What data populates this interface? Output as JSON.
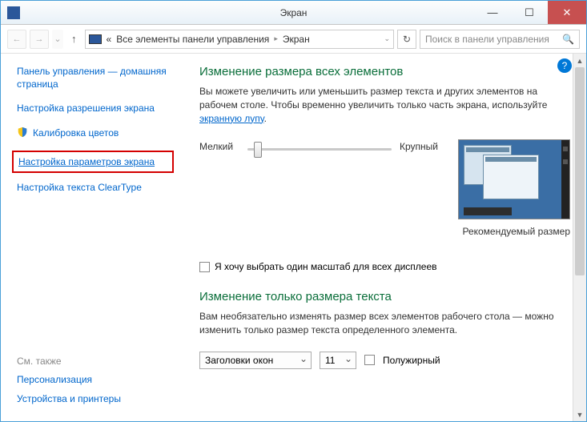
{
  "window": {
    "title": "Экран"
  },
  "breadcrumb": {
    "root": "Все элементы панели управления",
    "current": "Экран"
  },
  "search": {
    "placeholder": "Поиск в панели управления"
  },
  "sidebar": {
    "items": [
      "Панель управления — домашняя страница",
      "Настройка разрешения экрана",
      "Калибровка цветов",
      "Настройка параметров экрана",
      "Настройка текста ClearType"
    ],
    "seealso_header": "См. также",
    "seealso": [
      "Персонализация",
      "Устройства и принтеры"
    ]
  },
  "main": {
    "h1": "Изменение размера всех элементов",
    "desc_pre": "Вы можете увеличить или уменьшить размер текста и других элементов на рабочем столе. Чтобы временно увеличить только часть экрана, используйте ",
    "desc_link": "экранную лупу",
    "slider_min": "Мелкий",
    "slider_max": "Крупный",
    "recommended": "Рекомендуемый размер",
    "checkbox_label": "Я хочу выбрать один масштаб для всех дисплеев",
    "h2": "Изменение только размера текста",
    "desc2": "Вам необязательно изменять размер всех элементов рабочего стола — можно изменить только размер текста определенного элемента.",
    "select_element": "Заголовки окон",
    "select_size": "11",
    "bold_label": "Полужирный"
  }
}
